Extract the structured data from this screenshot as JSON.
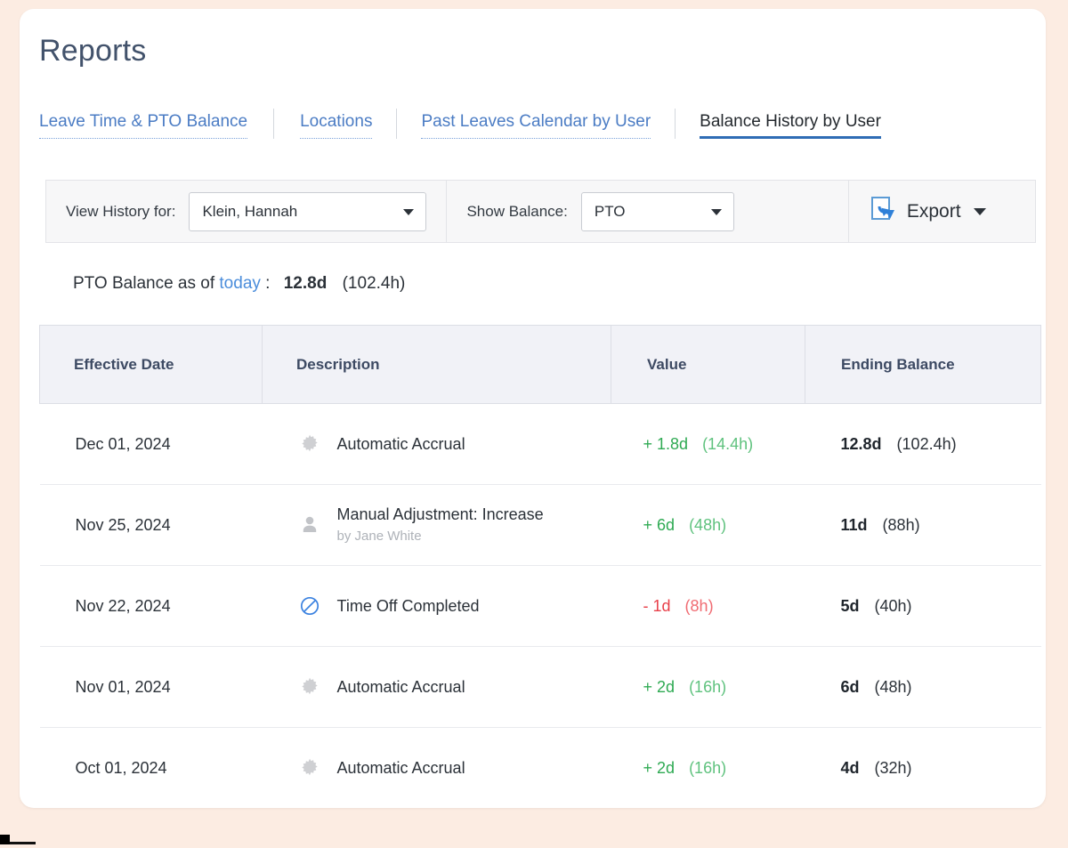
{
  "page": {
    "title": "Reports",
    "background_color": "#fcece2",
    "card_color": "#ffffff"
  },
  "tabs": [
    {
      "label": "Leave Time & PTO Balance",
      "active": false
    },
    {
      "label": "Locations",
      "active": false
    },
    {
      "label": "Past Leaves Calendar by User",
      "active": false
    },
    {
      "label": "Balance History by User",
      "active": true
    }
  ],
  "filters": {
    "user_label": "View History for:",
    "user_value": "Klein, Hannah",
    "balance_label": "Show Balance:",
    "balance_value": "PTO",
    "export_label": "Export",
    "export_icon": "export-document-download-icon"
  },
  "summary": {
    "prefix": "PTO Balance as of",
    "link": "today",
    "colon": ":",
    "days": "12.8d",
    "hours": "(102.4h)"
  },
  "table": {
    "columns": [
      "Effective Date",
      "Description",
      "Value",
      "Ending Balance"
    ],
    "rows": [
      {
        "date": "Dec 01, 2024",
        "icon": "gear-icon",
        "description": "Automatic Accrual",
        "sub": "",
        "value_days": "+ 1.8d",
        "value_hours": "(14.4h)",
        "value_sign": "positive",
        "end_days": "12.8d",
        "end_hours": "(102.4h)"
      },
      {
        "date": "Nov 25, 2024",
        "icon": "user-icon",
        "description": "Manual Adjustment: Increase",
        "sub": "by Jane White",
        "value_days": "+ 6d",
        "value_hours": "(48h)",
        "value_sign": "positive",
        "end_days": "11d",
        "end_hours": "(88h)"
      },
      {
        "date": "Nov 22, 2024",
        "icon": "no-entry-icon",
        "description": "Time Off Completed",
        "sub": "",
        "value_days": "- 1d",
        "value_hours": "(8h)",
        "value_sign": "negative",
        "end_days": "5d",
        "end_hours": "(40h)"
      },
      {
        "date": "Nov 01, 2024",
        "icon": "gear-icon",
        "description": "Automatic Accrual",
        "sub": "",
        "value_days": "+ 2d",
        "value_hours": "(16h)",
        "value_sign": "positive",
        "end_days": "6d",
        "end_hours": "(48h)"
      },
      {
        "date": "Oct 01, 2024",
        "icon": "gear-icon",
        "description": "Automatic Accrual",
        "sub": "",
        "value_days": "+ 2d",
        "value_hours": "(16h)",
        "value_sign": "positive",
        "end_days": "4d",
        "end_hours": "(32h)"
      }
    ]
  },
  "colors": {
    "accent_blue": "#2f6db5",
    "link_blue": "#4b8ddb",
    "positive_green": "#2faa53",
    "negative_red": "#e8404a",
    "title_slate": "#42526b"
  }
}
